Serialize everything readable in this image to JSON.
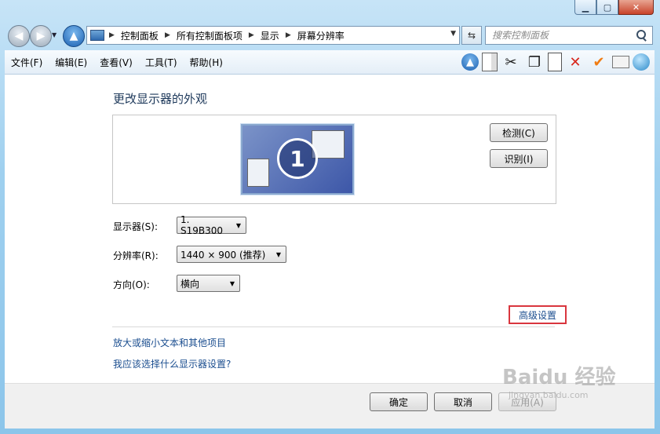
{
  "window": {
    "min_icon": "minimize-icon",
    "max_icon": "maximize-icon",
    "close_icon": "close-icon"
  },
  "nav": {
    "breadcrumbs": [
      "控制面板",
      "所有控制面板项",
      "显示",
      "屏幕分辨率"
    ],
    "search_placeholder": "搜索控制面板"
  },
  "menu": {
    "items": [
      "文件(F)",
      "编辑(E)",
      "查看(V)",
      "工具(T)",
      "帮助(H)"
    ]
  },
  "main": {
    "title": "更改显示器的外观",
    "monitor_number": "1",
    "detect_label": "检测(C)",
    "identify_label": "识别(I)",
    "display_label": "显示器(S):",
    "display_value": "1. S19B300",
    "resolution_label": "分辨率(R):",
    "resolution_value": "1440 × 900 (推荐)",
    "orientation_label": "方向(O):",
    "orientation_value": "横向",
    "advanced_link": "高级设置",
    "link_text_size": "放大或缩小文本和其他项目",
    "link_which_settings": "我应该选择什么显示器设置?"
  },
  "footer": {
    "ok_label": "确定",
    "cancel_label": "取消",
    "apply_label": "应用(A)"
  },
  "watermark": {
    "text": "Baidu 经验",
    "sub": "jingyan.baidu.com"
  }
}
